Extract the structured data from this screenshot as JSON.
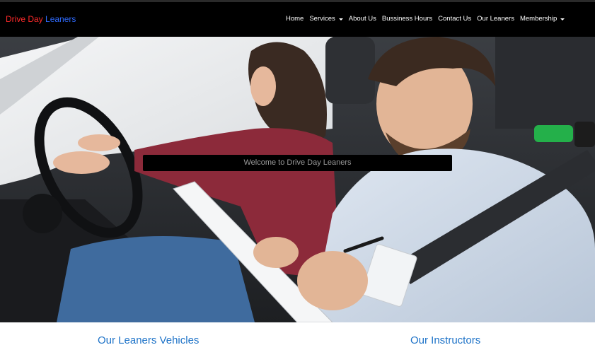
{
  "brand": {
    "part1": "Drive Day",
    "part2": "Leaners",
    "colors": {
      "part1": "#ff2a2a",
      "part2": "#2f6bff"
    }
  },
  "nav": {
    "items": [
      {
        "label": "Home",
        "dropdown": false
      },
      {
        "label": "Services",
        "dropdown": true
      },
      {
        "label": "About Us",
        "dropdown": false
      },
      {
        "label": "Bussiness Hours",
        "dropdown": false
      },
      {
        "label": "Contact Us",
        "dropdown": false
      },
      {
        "label": "Our Leaners",
        "dropdown": false
      },
      {
        "label": "Membership",
        "dropdown": true
      }
    ]
  },
  "hero": {
    "welcome_text": "Welcome to Drive Day Leaners"
  },
  "sections": {
    "vehicles_title": "Our Leaners Vehicles",
    "instructors_title": "Our Instructors"
  },
  "colors": {
    "navbar_bg": "#000000",
    "section_title": "#1e73c8"
  }
}
